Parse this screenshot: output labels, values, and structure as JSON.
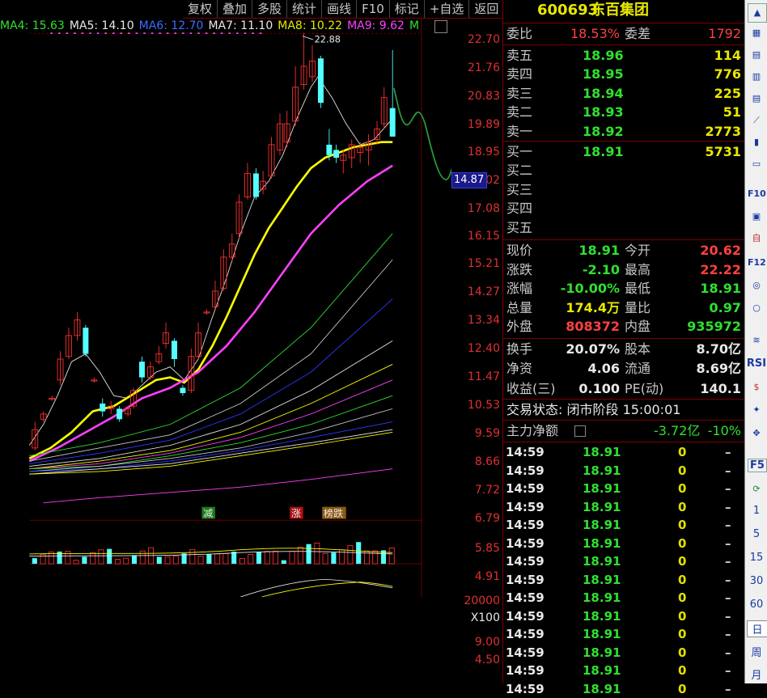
{
  "toolbar": {
    "items": [
      "复权",
      "叠加",
      "多股",
      "统计",
      "画线",
      "F10",
      "标记",
      "+自选",
      "返回"
    ]
  },
  "ma_legend": [
    {
      "label": "MA4: 15.63",
      "color": "#2fe02f"
    },
    {
      "label": "MA5: 14.10",
      "color": "#e8e8e8"
    },
    {
      "label": "MA6: 12.70",
      "color": "#3a6cff"
    },
    {
      "label": "MA7: 11.10",
      "color": "#e8e8e8"
    },
    {
      "label": "MA8: 10.22",
      "color": "#e8e800"
    },
    {
      "label": "MA9: 9.62",
      "color": "#ff40ff"
    },
    {
      "label": "M",
      "color": "#2fe02f"
    }
  ],
  "chart": {
    "peak_label": "22.88",
    "price_flag": "14.87",
    "price_axis": [
      "22.70",
      "21.76",
      "20.83",
      "19.89",
      "18.95",
      "18.02",
      "17.08",
      "16.15",
      "15.21",
      "14.27",
      "13.34",
      "12.40",
      "11.47",
      "10.53",
      "9.59",
      "8.66",
      "7.72",
      "6.79",
      "5.85",
      "4.91"
    ],
    "markers": [
      "减",
      "涨",
      "榜跌"
    ],
    "volume_axis": [
      "20000",
      "X100"
    ],
    "indicator_axis": [
      "9.00",
      "4.50"
    ]
  },
  "quote": {
    "code": "600693",
    "name": "东百集团",
    "weibi_label": "委比",
    "weibi_value": "18.53%",
    "weicha_label": "委差",
    "weicha_value": "1792",
    "asks": [
      {
        "label": "卖五",
        "price": "18.96",
        "vol": "114"
      },
      {
        "label": "卖四",
        "price": "18.95",
        "vol": "776"
      },
      {
        "label": "卖三",
        "price": "18.94",
        "vol": "225"
      },
      {
        "label": "卖二",
        "price": "18.93",
        "vol": "51"
      },
      {
        "label": "卖一",
        "price": "18.92",
        "vol": "2773"
      }
    ],
    "bids": [
      {
        "label": "买一",
        "price": "18.91",
        "vol": "5731"
      },
      {
        "label": "买二",
        "price": "",
        "vol": ""
      },
      {
        "label": "买三",
        "price": "",
        "vol": ""
      },
      {
        "label": "买四",
        "price": "",
        "vol": ""
      },
      {
        "label": "买五",
        "price": "",
        "vol": ""
      }
    ],
    "stats": [
      {
        "l1": "现价",
        "v1": "18.91",
        "c1": "green",
        "l2": "今开",
        "v2": "20.62",
        "c2": "red"
      },
      {
        "l1": "涨跌",
        "v1": "-2.10",
        "c1": "green",
        "l2": "最高",
        "v2": "22.22",
        "c2": "red"
      },
      {
        "l1": "涨幅",
        "v1": "-10.00%",
        "c1": "green",
        "l2": "最低",
        "v2": "18.91",
        "c2": "green"
      },
      {
        "l1": "总量",
        "v1": "174.4万",
        "c1": "yellow",
        "l2": "量比",
        "v2": "0.97",
        "c2": "green"
      },
      {
        "l1": "外盘",
        "v1": "808372",
        "c1": "red",
        "l2": "内盘",
        "v2": "935972",
        "c2": "green"
      }
    ],
    "stats2": [
      {
        "l1": "换手",
        "v1": "20.07%",
        "l2": "股本",
        "v2": "8.70亿"
      },
      {
        "l1": "净资",
        "v1": "4.06",
        "l2": "流通",
        "v2": "8.69亿"
      },
      {
        "l1": "收益(三)",
        "v1": "0.100",
        "l2": "PE(动)",
        "v2": "140.1"
      }
    ],
    "trade_status": "交易状态: 闭市阶段 15:00:01",
    "main_flow_label": "主力净额",
    "main_flow_value": "-3.72亿",
    "main_flow_pct": "-10%",
    "ticks": [
      {
        "time": "14:59",
        "price": "18.91",
        "qty": "0",
        "dir": "–"
      },
      {
        "time": "14:59",
        "price": "18.91",
        "qty": "0",
        "dir": "–"
      },
      {
        "time": "14:59",
        "price": "18.91",
        "qty": "0",
        "dir": "–"
      },
      {
        "time": "14:59",
        "price": "18.91",
        "qty": "0",
        "dir": "–"
      },
      {
        "time": "14:59",
        "price": "18.91",
        "qty": "0",
        "dir": "–"
      },
      {
        "time": "14:59",
        "price": "18.91",
        "qty": "0",
        "dir": "–"
      },
      {
        "time": "14:59",
        "price": "18.91",
        "qty": "0",
        "dir": "–"
      },
      {
        "time": "14:59",
        "price": "18.91",
        "qty": "0",
        "dir": "–"
      },
      {
        "time": "14:59",
        "price": "18.91",
        "qty": "0",
        "dir": "–"
      },
      {
        "time": "14:59",
        "price": "18.91",
        "qty": "0",
        "dir": "–"
      },
      {
        "time": "14:59",
        "price": "18.91",
        "qty": "0",
        "dir": "–"
      },
      {
        "time": "14:59",
        "price": "18.91",
        "qty": "0",
        "dir": "–"
      },
      {
        "time": "14:59",
        "price": "18.91",
        "qty": "0",
        "dir": "–"
      },
      {
        "time": "14:59",
        "price": "18.91",
        "qty": "0",
        "dir": "–"
      }
    ]
  },
  "sidebar": {
    "text_items": [
      "RSI",
      "F5",
      "1",
      "5",
      "15",
      "30",
      "60",
      "日",
      "周",
      "月"
    ]
  }
}
